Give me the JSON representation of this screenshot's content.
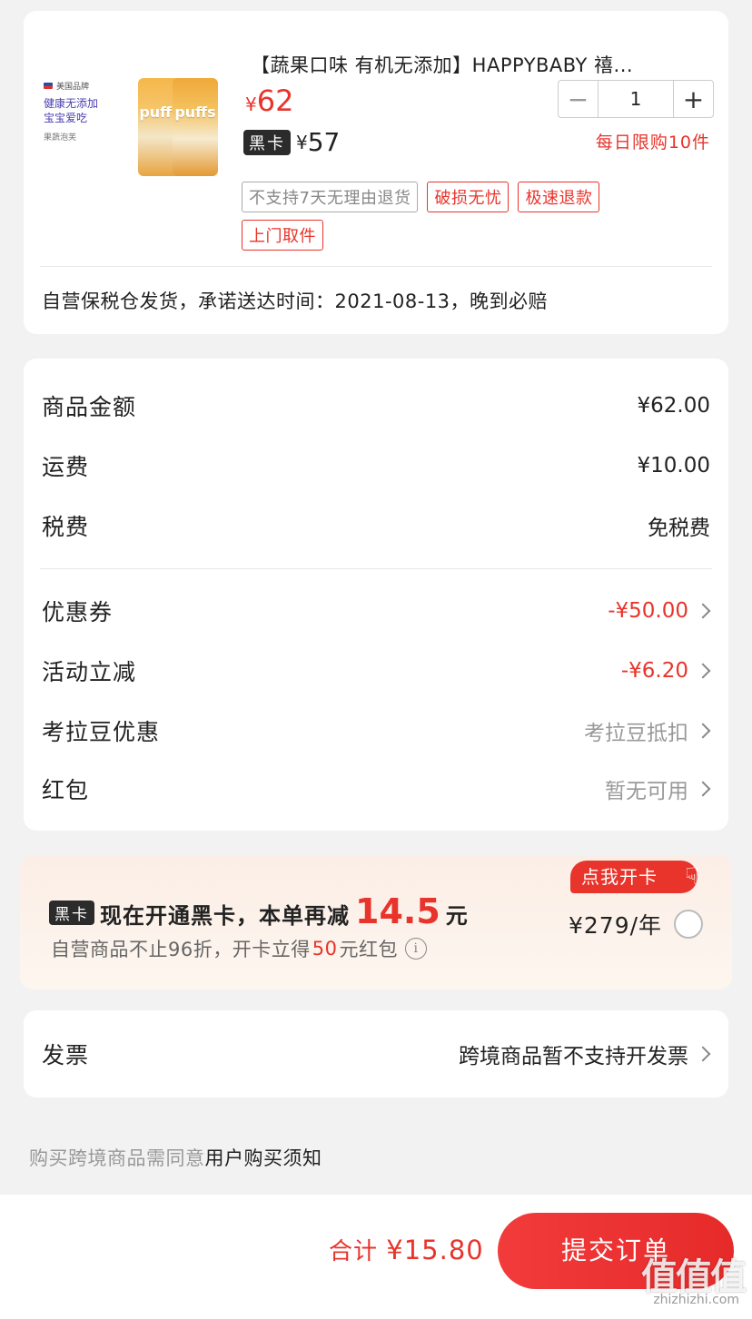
{
  "product": {
    "thumb_flag_text": "美国品牌",
    "thumb_tag_line1": "健康无添加",
    "thumb_tag_line2": "宝宝爱吃",
    "thumb_tag_line3": "果蔬泡芙",
    "thumb_can_label": "puffs",
    "title": "【蔬果口味 有机无添加】HAPPYBABY 禧...",
    "price_currency": "¥",
    "price": "62",
    "black_card_badge": "黑卡",
    "black_price_currency": "¥",
    "black_price": "57",
    "quantity": "1",
    "limit_text": "每日限购10件",
    "tags": [
      "不支持7天无理由退货",
      "破损无忧",
      "极速退款",
      "上门取件"
    ],
    "shipping_text": "自营保税仓发货，承诺送达时间：2021-08-13，晚到必赔"
  },
  "costs": {
    "goods_amount_label": "商品金额",
    "goods_amount": "¥62.00",
    "freight_label": "运费",
    "freight": "¥10.00",
    "tax_label": "税费",
    "tax": "免税费",
    "coupon_label": "优惠券",
    "coupon": "-¥50.00",
    "activity_label": "活动立减",
    "activity": "-¥6.20",
    "kaola_label": "考拉豆优惠",
    "kaola": "考拉豆抵扣",
    "redpack_label": "红包",
    "redpack": "暂无可用"
  },
  "promo": {
    "badge_text": "点我开卡",
    "black_card_badge": "黑卡",
    "line1_text": "现在开通黑卡，本单再减",
    "line1_amount": "14.5",
    "line1_unit": "元",
    "line2_before": "自营商品不止96折，开卡立得",
    "line2_amount": "50",
    "line2_after": "元红包",
    "price_text": "¥279/年"
  },
  "invoice": {
    "label": "发票",
    "value": "跨境商品暂不支持开发票"
  },
  "notice": {
    "text": "购买跨境商品需同意",
    "link": "用户购买须知"
  },
  "footer": {
    "total_label": "合计",
    "total_amount": "¥15.80",
    "submit_label": "提交订单",
    "watermark": "值值值",
    "watermark_url": "zhizhizhi.com"
  },
  "colors": {
    "accent_red": "#e8342b",
    "black_card": "#2b2b2b",
    "background": "#f2f2f2"
  }
}
